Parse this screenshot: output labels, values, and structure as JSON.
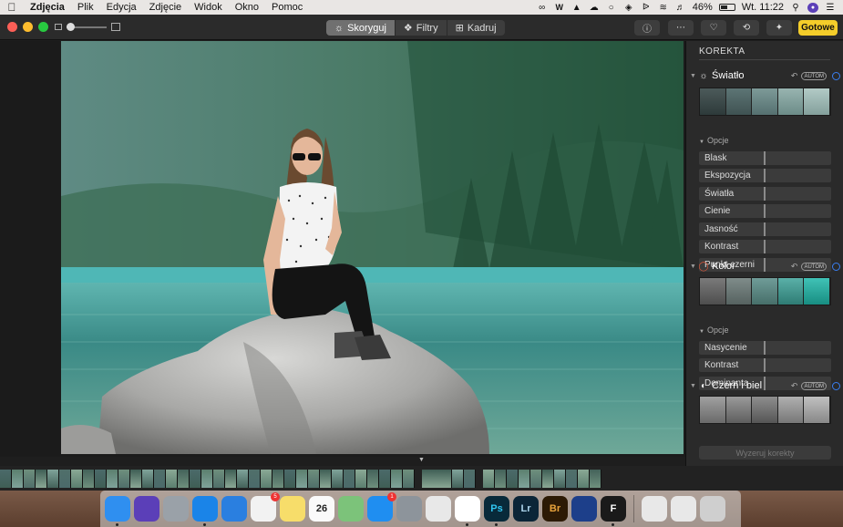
{
  "menubar": {
    "app_name": "Zdjęcia",
    "menus": [
      "Plik",
      "Edycja",
      "Zdjęcie",
      "Widok",
      "Okno",
      "Pomoc"
    ],
    "battery": "46%",
    "clock": "Wt. 11:22"
  },
  "toolbar": {
    "tabs": [
      {
        "label": "Skoryguj",
        "icon": "adjust-icon",
        "active": true
      },
      {
        "label": "Filtry",
        "icon": "filters-icon",
        "active": false
      },
      {
        "label": "Kadruj",
        "icon": "crop-icon",
        "active": false
      }
    ],
    "done_label": "Gotowe"
  },
  "panel": {
    "title": "KOREKTA",
    "options_label": "Opcje",
    "auto_label": "AUTOM",
    "sections": {
      "light": {
        "title": "Światło",
        "sliders": [
          "Blask",
          "Ekspozycja",
          "Światła",
          "Cienie",
          "Jasność",
          "Kontrast",
          "Punkt czerni"
        ]
      },
      "color": {
        "title": "Kolor",
        "sliders": [
          "Nasycenie",
          "Kontrast",
          "Dominanta"
        ]
      },
      "bw": {
        "title": "Czerń i biel"
      }
    },
    "reset_label": "Wyzeruj korekty"
  },
  "dock": {
    "items": [
      {
        "name": "finder-icon",
        "color": "#2f8ff0",
        "text": "",
        "running": true
      },
      {
        "name": "siri-icon",
        "color": "#5b3fb8",
        "text": "",
        "running": false
      },
      {
        "name": "launchpad-icon",
        "color": "#9aa1a8",
        "text": "",
        "running": false
      },
      {
        "name": "safari-icon",
        "color": "#1a84e8",
        "text": "",
        "running": true
      },
      {
        "name": "spark-icon",
        "color": "#2a7fe0",
        "text": "",
        "running": false
      },
      {
        "name": "reminders-icon",
        "color": "#f2f2f2",
        "text": "",
        "running": false,
        "badge": "5"
      },
      {
        "name": "notes-icon",
        "color": "#f7dd6a",
        "text": "",
        "running": false
      },
      {
        "name": "calendar-icon",
        "color": "#fafafa",
        "text": "26",
        "running": false
      },
      {
        "name": "maps-icon",
        "color": "#7cc37a",
        "text": "",
        "running": false
      },
      {
        "name": "app-store-icon",
        "color": "#1f8ef1",
        "text": "",
        "running": false,
        "badge": "1"
      },
      {
        "name": "system-preferences-icon",
        "color": "#8d949b",
        "text": "",
        "running": false
      },
      {
        "name": "bird-app-icon",
        "color": "#e8e8e8",
        "text": "",
        "running": false
      },
      {
        "name": "photos-icon",
        "color": "#ffffff",
        "text": "",
        "running": true
      },
      {
        "name": "photoshop-icon",
        "color": "#082a3a",
        "text": "Ps",
        "running": true
      },
      {
        "name": "lightroom-icon",
        "color": "#0b2537",
        "text": "Lr",
        "running": false
      },
      {
        "name": "bridge-icon",
        "color": "#2c1a05",
        "text": "Br",
        "running": false
      },
      {
        "name": "affinity-icon",
        "color": "#1d3f8a",
        "text": "",
        "running": false
      },
      {
        "name": "font-app-icon",
        "color": "#1a1a1a",
        "text": "F",
        "running": true
      }
    ],
    "right_items": [
      {
        "name": "folder-icon",
        "color": "#e8e8e8"
      },
      {
        "name": "screens-icon",
        "color": "#e8e8e8"
      },
      {
        "name": "trash-icon",
        "color": "#cfcfcf"
      }
    ]
  }
}
